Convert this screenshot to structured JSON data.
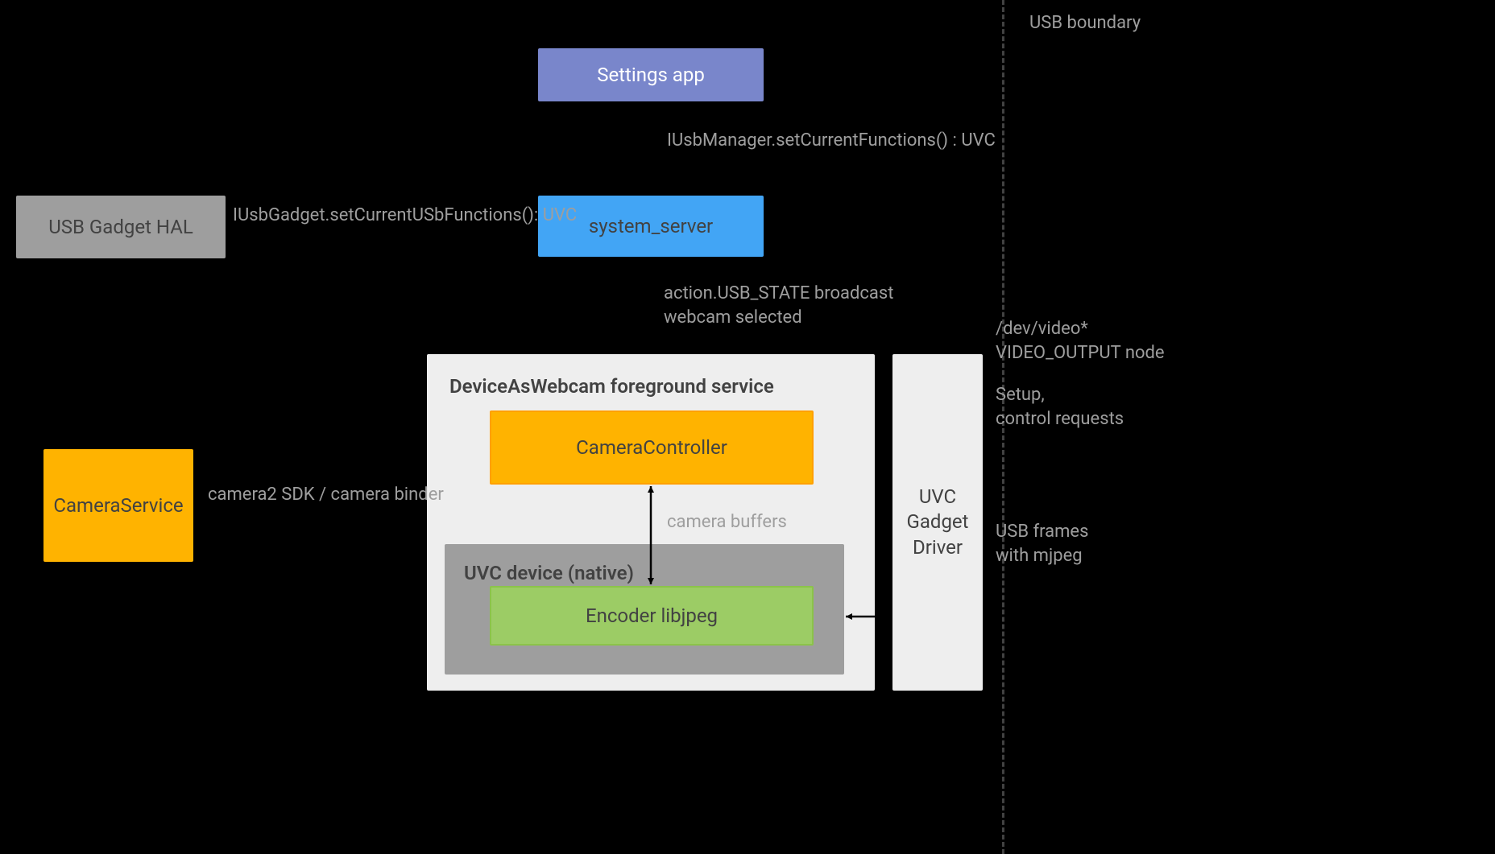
{
  "boxes": {
    "settings_app": "Settings app",
    "usb_gadget_hal": "USB Gadget HAL",
    "system_server": "system_server",
    "camera_service": "CameraService",
    "camera_controller": "CameraController",
    "encoder_libjpeg": "Encoder libjpeg",
    "uvc_gadget_driver": "UVC\nGadget\nDriver"
  },
  "containers": {
    "dawfs_title": "DeviceAsWebcam foreground service",
    "uvc_native_title": "UVC device (native)"
  },
  "labels": {
    "usb_boundary": "USB boundary",
    "iusbmanager": "IUsbManager.setCurrentFunctions() : UVC",
    "iusbgadget": "IUsbGadget.setCurrentUSbFunctions(): UVC",
    "usb_state_broadcast": "action.USB_STATE broadcast\nwebcam selected",
    "dev_video": "/dev/video*\nVIDEO_OUTPUT node",
    "setup_control": "Setup,\ncontrol requests",
    "camera_buffers": "camera buffers",
    "camera2_sdk": "camera2 SDK / camera binder",
    "usb_frames": "USB frames\nwith mjpeg"
  }
}
